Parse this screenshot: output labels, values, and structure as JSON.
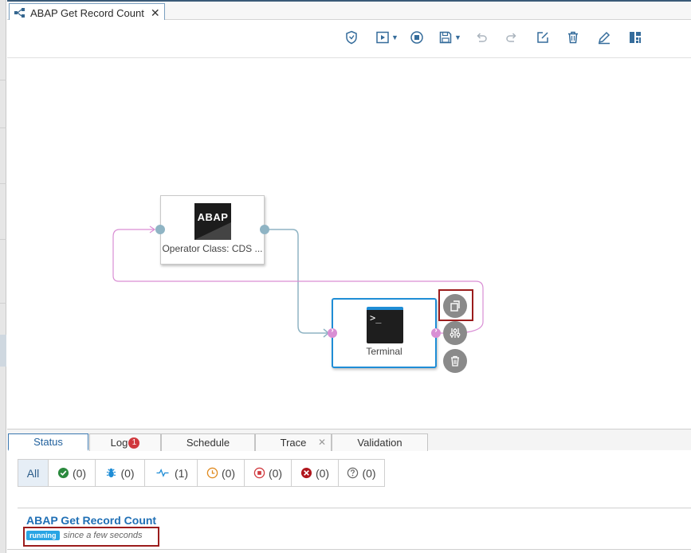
{
  "tab": {
    "title": "ABAP Get Record Count",
    "close": "✕"
  },
  "toolbar": {
    "icons": [
      "shield-check-icon",
      "run-icon",
      "stop-icon",
      "save-icon",
      "undo-icon",
      "redo-icon",
      "edit-icon",
      "trash-icon",
      "pencil-icon",
      "layout-icon"
    ]
  },
  "nodes": {
    "abap": {
      "logo_text": "ABAP",
      "label": "Operator Class: CDS ..."
    },
    "terminal": {
      "prompt": ">_",
      "label": "Terminal"
    }
  },
  "colors": {
    "accent": "#1f8dd6",
    "port_in": "#8fb4c4",
    "port_loop": "#d98ed4",
    "highlight": "#9b1c1c",
    "running": "#29a5e4"
  },
  "panel": {
    "tabs": [
      {
        "label": "Status"
      },
      {
        "label": "Log",
        "badge": "1"
      },
      {
        "label": "Schedule"
      },
      {
        "label": "Trace",
        "close": "✕"
      },
      {
        "label": "Validation"
      }
    ],
    "filters": [
      {
        "label": "All"
      },
      {
        "count": "(0)",
        "icon": "check-circle-icon"
      },
      {
        "count": "(0)",
        "icon": "bug-icon"
      },
      {
        "count": "(1)",
        "icon": "pulse-icon"
      },
      {
        "count": "(0)",
        "icon": "clock-icon"
      },
      {
        "count": "(0)",
        "icon": "stop-circle-icon"
      },
      {
        "count": "(0)",
        "icon": "error-circle-icon"
      },
      {
        "count": "(0)",
        "icon": "question-circle-icon"
      }
    ],
    "graph_title": "ABAP Get Record Count",
    "status": "running",
    "since": "since a few seconds"
  }
}
